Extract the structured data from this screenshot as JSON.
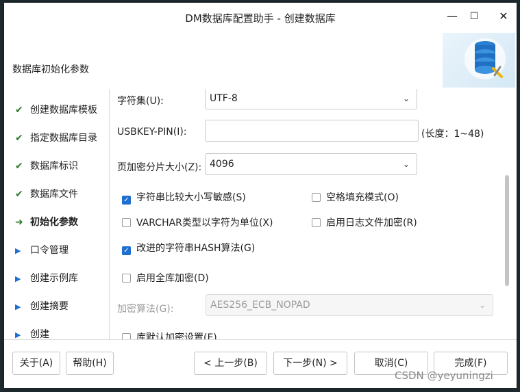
{
  "window": {
    "title": "DM数据库配置助手 - 创建数据库"
  },
  "window_controls": {
    "minimize": "—",
    "maximize": "☐",
    "close": "✕"
  },
  "header": {
    "title": "数据库初始化参数"
  },
  "sidebar": {
    "items": [
      {
        "label": "创建数据库模板",
        "state": "done",
        "icon": "✔"
      },
      {
        "label": "指定数据库目录",
        "state": "done",
        "icon": "✔"
      },
      {
        "label": "数据库标识",
        "state": "done",
        "icon": "✔"
      },
      {
        "label": "数据库文件",
        "state": "done",
        "icon": "✔"
      },
      {
        "label": "初始化参数",
        "state": "current",
        "icon": "➜"
      },
      {
        "label": "口令管理",
        "state": "todo",
        "icon": "▶"
      },
      {
        "label": "创建示例库",
        "state": "todo",
        "icon": "▶"
      },
      {
        "label": "创建摘要",
        "state": "todo",
        "icon": "▶"
      },
      {
        "label": "创建",
        "state": "todo",
        "icon": "▶"
      }
    ]
  },
  "form": {
    "charset_label": "字符集(U):",
    "charset_value": "UTF-8",
    "usbkey_label": "USBKEY-PIN(I):",
    "usbkey_value": "",
    "usbkey_hint": "(长度：1~48)",
    "page_enc_label": "页加密分片大小(Z):",
    "page_enc_value": "4096",
    "checkboxes": {
      "case_sensitive": {
        "label": "字符串比较大小写敏感(S)",
        "checked": true
      },
      "blank_pad": {
        "label": "空格填充模式(O)",
        "checked": false
      },
      "varchar_char": {
        "label": "VARCHAR类型以字符为单位(X)",
        "checked": false
      },
      "log_encrypt": {
        "label": "启用日志文件加密(R)",
        "checked": false
      },
      "hash_algo": {
        "label": "改进的字符串HASH算法(G)",
        "checked": true
      },
      "full_encrypt": {
        "label": "启用全库加密(D)",
        "checked": false
      },
      "default_encrypt": {
        "label": "库默认加密设置(E)",
        "checked": false
      }
    },
    "enc_algo_label": "加密算法(G):",
    "enc_algo_value": "AES256_ECB_NOPAD"
  },
  "footer": {
    "about": "关于(A)",
    "help": "帮助(H)",
    "prev": "< 上一步(B)",
    "next": "下一步(N) >",
    "cancel": "取消(C)",
    "finish": "完成(F)"
  },
  "watermark": "CSDN @yeyuningzi"
}
